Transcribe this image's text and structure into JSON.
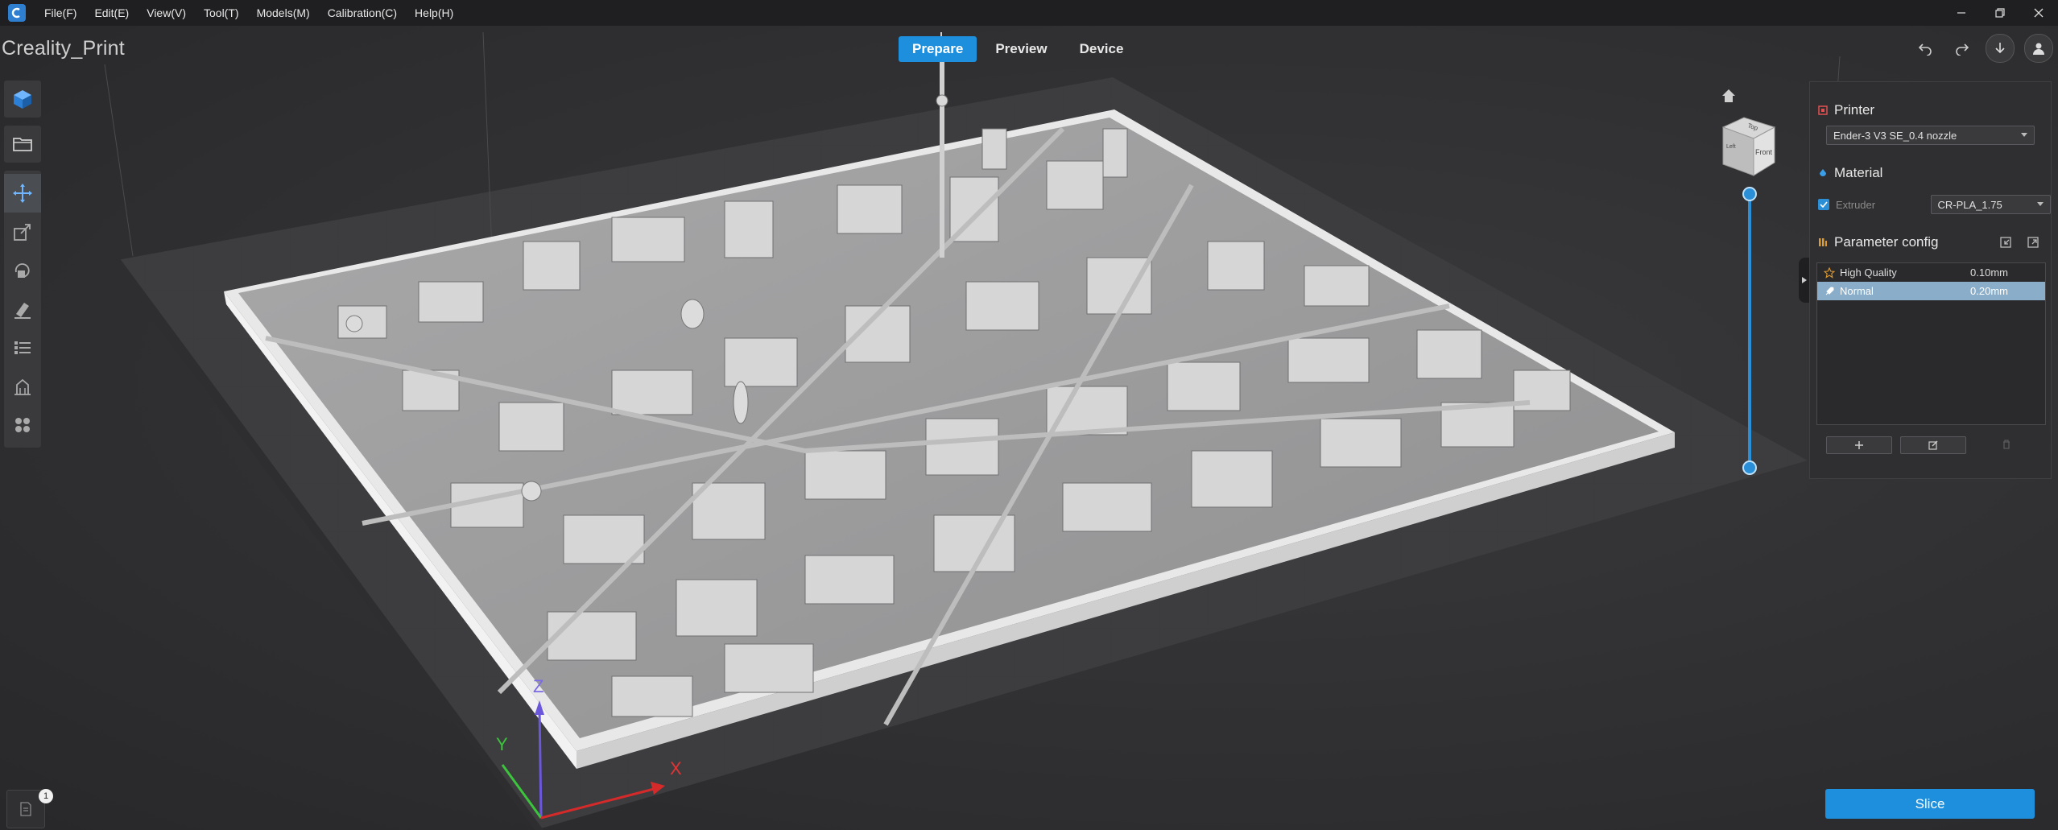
{
  "menu": [
    "File(F)",
    "Edit(E)",
    "View(V)",
    "Tool(T)",
    "Models(M)",
    "Calibration(C)",
    "Help(H)"
  ],
  "app_title": "Creality_Print",
  "mode_tabs": {
    "prepare": "Prepare",
    "preview": "Preview",
    "device": "Device"
  },
  "view_cube": {
    "top": "Top",
    "front": "Front",
    "left": "Left"
  },
  "axes": {
    "x": "X",
    "y": "Y",
    "z": "Z"
  },
  "panel": {
    "printer_title": "Printer",
    "printer_value": "Ender-3 V3 SE_0.4 nozzle",
    "material_title": "Material",
    "extruder_label": "Extruder",
    "material_value": "CR-PLA_1.75",
    "param_title": "Parameter config",
    "qualities": [
      {
        "name": "High Quality",
        "value": "0.10mm"
      },
      {
        "name": "Normal",
        "value": "0.20mm"
      }
    ]
  },
  "slice_label": "Slice",
  "notes_count": "1",
  "colors": {
    "accent": "#1e8fdc",
    "selected_row": "#8aaec9",
    "background": "#2b2b2d"
  },
  "icons": [
    "app-logo-icon",
    "minimize-icon",
    "restore-icon",
    "close-icon",
    "undo-icon",
    "redo-icon",
    "download-icon",
    "user-icon",
    "cube-icon",
    "folder-icon",
    "move-icon",
    "scale-icon",
    "rotate-icon",
    "paint-icon",
    "list-icon",
    "support-icon",
    "arrange-icon",
    "home-icon",
    "printer-icon",
    "material-icon",
    "param-icon",
    "import-icon",
    "export-icon",
    "plus-icon",
    "edit-icon",
    "delete-icon",
    "notes-icon"
  ]
}
